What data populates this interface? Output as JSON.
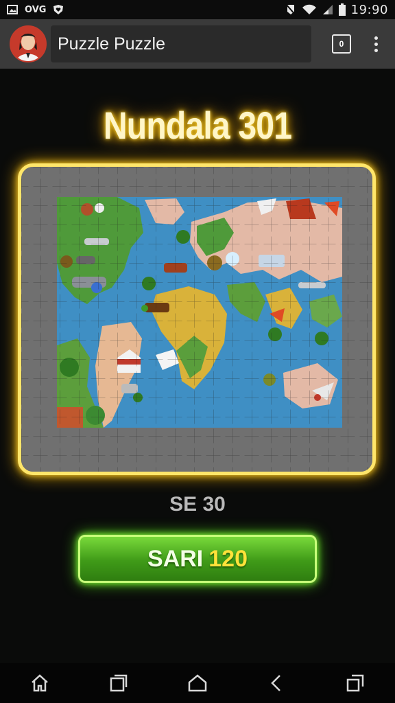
{
  "status_bar": {
    "carrier": "OVG",
    "time": "19:90",
    "icons": [
      "image-icon",
      "heart-shield-icon",
      "mute-icon",
      "wifi-icon",
      "signal-icon",
      "battery-icon"
    ]
  },
  "app_bar": {
    "title": "Puzzle Puzzle",
    "tab_count": "0",
    "icons": [
      "avatar",
      "tabs-icon",
      "overflow-menu-icon"
    ]
  },
  "game": {
    "title": "Nundala 301",
    "subtitle": "SE 30",
    "play_label": "SARI",
    "play_value": "120",
    "frame_color": "#ffe66a",
    "button_color": "#5cc22a",
    "puzzle": {
      "grid_cols": 18,
      "grid_rows": 16,
      "image": "world-map-puzzle"
    }
  },
  "nav_bar": {
    "icons": [
      "home-icon",
      "recents-icon",
      "home-outline-icon",
      "back-icon",
      "overview-icon"
    ]
  }
}
